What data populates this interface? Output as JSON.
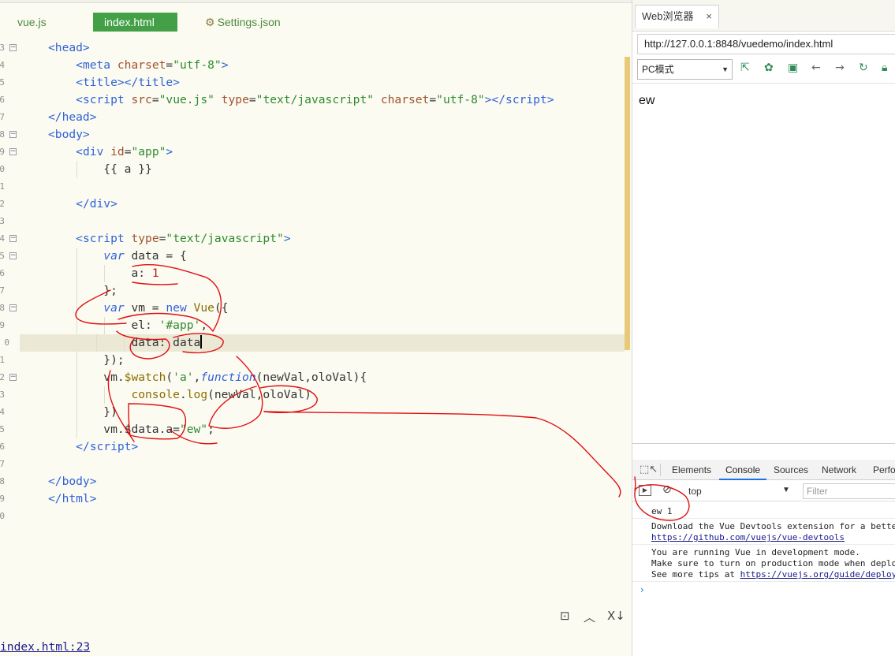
{
  "editor": {
    "tabs": [
      {
        "label": "vue.js"
      },
      {
        "label": "index.html"
      },
      {
        "label": "Settings.json"
      }
    ],
    "lines": [
      {
        "no": "3",
        "html": "<span class=\"tag\">&lt;head&gt;</span>"
      },
      {
        "no": "4",
        "html": "    <span class=\"tag\">&lt;meta</span> <span class=\"attr\">charset</span>=<span class=\"str\">\"utf-8\"</span><span class=\"tag\">&gt;</span>"
      },
      {
        "no": "5",
        "html": "    <span class=\"tag\">&lt;title&gt;&lt;/title&gt;</span>"
      },
      {
        "no": "6",
        "html": "    <span class=\"tag\">&lt;script</span> <span class=\"attr\">src</span>=<span class=\"str\">\"vue.js\"</span> <span class=\"attr\">type</span>=<span class=\"str\">\"text/javascript\"</span> <span class=\"attr\">charset</span>=<span class=\"str\">\"utf-8\"</span><span class=\"tag\">&gt;&lt;/script&gt;</span>"
      },
      {
        "no": "7",
        "html": "<span class=\"tag\">&lt;/head&gt;</span>"
      },
      {
        "no": "8",
        "html": "<span class=\"tag\">&lt;body&gt;</span>"
      },
      {
        "no": "9",
        "html": "    <span class=\"tag\">&lt;div</span> <span class=\"attr\">id</span>=<span class=\"str\">\"app\"</span><span class=\"tag\">&gt;</span>"
      },
      {
        "no": "0",
        "html": "        <span class=\"plain\">{{ a }}</span>"
      },
      {
        "no": "1",
        "html": ""
      },
      {
        "no": "2",
        "html": "    <span class=\"tag\">&lt;/div&gt;</span>"
      },
      {
        "no": "3",
        "html": ""
      },
      {
        "no": "4",
        "html": "    <span class=\"tag\">&lt;script</span> <span class=\"attr\">type</span>=<span class=\"str\">\"text/javascript\"</span><span class=\"tag\">&gt;</span>"
      },
      {
        "no": "5",
        "html": "        <span class=\"kw\">var</span> <span class=\"plain\">data = {</span>"
      },
      {
        "no": "6",
        "html": "            <span class=\"plain\">a: </span><span class=\"num\">1</span>"
      },
      {
        "no": "7",
        "html": "        <span class=\"plain\">};</span>"
      },
      {
        "no": "8",
        "html": "        <span class=\"kw\">var</span> <span class=\"plain\">vm = </span><span class=\"tag\">new</span> <span class=\"fn\">Vue</span><span class=\"plain\">({</span>"
      },
      {
        "no": "9",
        "html": "            <span class=\"plain\">el: </span><span class=\"str\">'#app'</span><span class=\"plain\">,</span>"
      },
      {
        "no": "0",
        "html": "            <span class=\"plain\">data: data</span><span class=\"caret\"></span>"
      },
      {
        "no": "1",
        "html": "        <span class=\"plain\">});</span>"
      },
      {
        "no": "2",
        "html": "        <span class=\"plain\">vm.</span><span class=\"fn\">$watch</span><span class=\"plain\">(</span><span class=\"str\">'a'</span><span class=\"plain\">,</span><span class=\"kw\">function</span><span class=\"plain\">(newVal,oloVal){</span>"
      },
      {
        "no": "3",
        "html": "            <span class=\"fn\">console</span><span class=\"plain\">.</span><span class=\"fn\">log</span><span class=\"plain\">(newVal,oloVal)</span>"
      },
      {
        "no": "4",
        "html": "        <span class=\"plain\">})</span>"
      },
      {
        "no": "5",
        "html": "        <span class=\"plain\">vm.$data.a=</span><span class=\"str\">\"ew\"</span><span class=\"plain\">;</span>"
      },
      {
        "no": "6",
        "html": "    <span class=\"tag\">&lt;/script&gt;</span>"
      },
      {
        "no": "7",
        "html": ""
      },
      {
        "no": "8",
        "html": "<span class=\"tag\">&lt;/body&gt;</span>"
      },
      {
        "no": "9",
        "html": "<span class=\"tag\">&lt;/html&gt;</span>"
      },
      {
        "no": "0",
        "html": ""
      }
    ],
    "console_link": "index.html:23"
  },
  "browser": {
    "tab_title": "Web浏览器",
    "tab_close": "×",
    "url": "http://127.0.0.1:8848/vuedemo/index.html",
    "mode": "PC模式",
    "page_text": "ew"
  },
  "devtools": {
    "tabs": [
      "Elements",
      "Console",
      "Sources",
      "Network",
      "Perfo"
    ],
    "active_tab": "Console",
    "context": "top",
    "filter_placeholder": "Filter",
    "messages": {
      "m1": "ew 1",
      "m2_line1": "Download the Vue Devtools extension for a bette",
      "m2_link": "https://github.com/vuejs/vue-devtools",
      "m3_line1": "You are running Vue in development mode.",
      "m3_line2": "Make sure to turn on production mode when deplo",
      "m3_line3_prefix": "See more tips at ",
      "m3_link": "https://vuejs.org/guide/deploy"
    },
    "prompt": "›"
  },
  "icons": {
    "settings_tab": "gear-icon",
    "toolbar": [
      "open-external-icon",
      "settings-icon",
      "terminal-icon",
      "back-icon",
      "forward-icon",
      "refresh-icon",
      "lock-icon"
    ],
    "editor_bottom": [
      "image-icon",
      "chevron-up-icon",
      "close-x-icon"
    ]
  },
  "colors": {
    "active_tab": "#43a047",
    "annotation": "#e01010",
    "devtools_active": "#1a73e8"
  }
}
